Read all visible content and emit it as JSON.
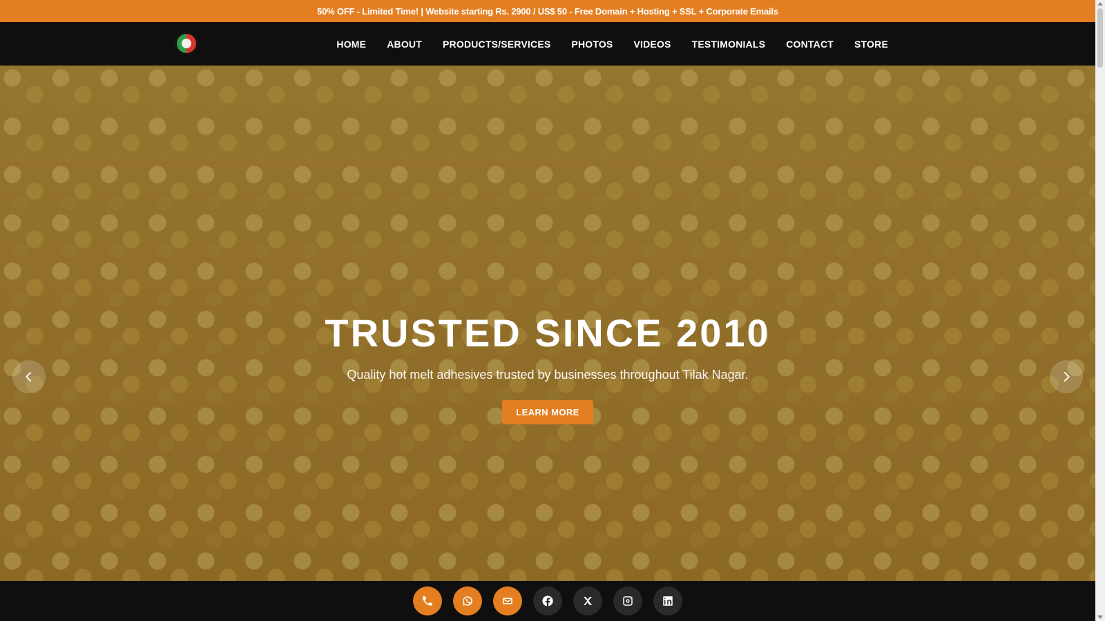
{
  "promo": {
    "text": "50% OFF - Limited Time! | Website starting Rs. 2900 / US$ 50 - Free Domain + Hosting + SSL + Corporate Emails"
  },
  "nav": {
    "items": [
      "HOME",
      "ABOUT",
      "PRODUCTS/SERVICES",
      "PHOTOS",
      "VIDEOS",
      "TESTIMONIALS",
      "CONTACT",
      "STORE"
    ]
  },
  "hero": {
    "title": "TRUSTED SINCE 2010",
    "subtitle": "Quality hot melt adhesives trusted by businesses throughout Tilak Nagar.",
    "cta_label": "LEARN MORE"
  },
  "carousel": {
    "prev_icon": "chevron-left-icon",
    "next_icon": "chevron-right-icon"
  },
  "bottom_bar": {
    "icons": [
      "phone-icon",
      "whatsapp-icon",
      "mail-icon",
      "facebook-icon",
      "x-icon",
      "instagram-icon",
      "linkedin-icon"
    ]
  },
  "colors": {
    "accent": "#e47f21",
    "header_bg": "#0f0f0f"
  }
}
